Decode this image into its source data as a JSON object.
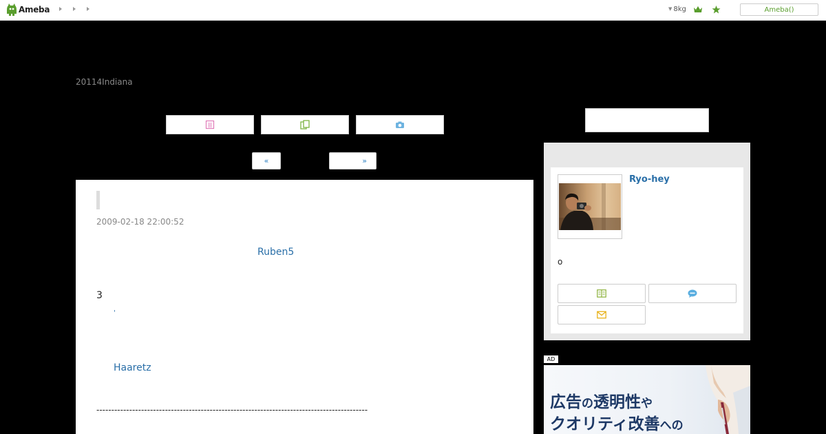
{
  "topbar": {
    "logo_text": "Ameba",
    "weight_text": "8kg",
    "ameba_button": "Ameba()"
  },
  "header": {
    "description": "20114Indiana"
  },
  "pager": {
    "prev_label": "«",
    "next_label": "»"
  },
  "article": {
    "date": "2009-02-18 22:00:52",
    "link1": "Ruben5",
    "number": "3",
    "tick": "'",
    "link2": "Haaretz",
    "rule": "-------------------------------------------------------------------------------------------"
  },
  "profile": {
    "name": "Ryo-hey",
    "text": "o"
  },
  "ad": {
    "badge": "AD",
    "line1_a": "広告",
    "line1_b": "の",
    "line1_c": "透明性",
    "line1_d": "や",
    "line2_a": "クオリティ改善",
    "line2_b": "への"
  },
  "colors": {
    "link": "#2a6fa8",
    "brand_green": "#5a9e2e",
    "page_bg": "#000000"
  }
}
